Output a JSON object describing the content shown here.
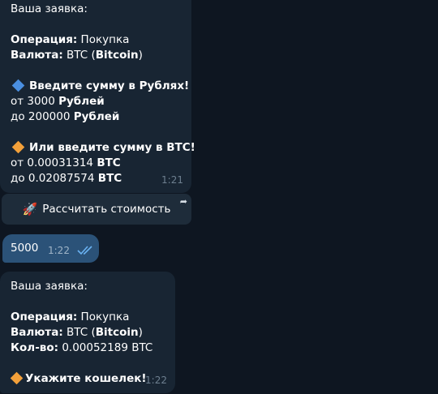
{
  "chat": {
    "msg1": {
      "header": "Ваша заявка:",
      "op_label": "Операция:",
      "op_value": " Покупка",
      "cur_label": "Валюта:",
      "cur_value_pre": " BTC (",
      "cur_value_name": "Bitcoin",
      "cur_value_post": ")",
      "rub_title": "Введите сумму в Рублях!",
      "rub_from_pre": "от ",
      "rub_from_val": "3000 ",
      "rub_from_unit": "Рублей",
      "rub_to_pre": "до ",
      "rub_to_val": "200000 ",
      "rub_to_unit": "Рублей",
      "btc_title": "Или введите сумму в BTC!",
      "btc_from_pre": "от ",
      "btc_from_val": "0.00031314 ",
      "btc_from_unit": "BTC",
      "btc_to_pre": "до ",
      "btc_to_val": "0.02087574 ",
      "btc_to_unit": "BTC",
      "time": "1:21",
      "icons": {
        "rub": "blue-diamond-icon",
        "btc": "orange-diamond-icon"
      },
      "colors": {
        "blue_diamond": "#4a8fe0",
        "orange_diamond": "#f2a03a"
      }
    },
    "inline_button": {
      "label": "Рассчитать стоимость",
      "icon": "rocket-icon"
    },
    "outgoing": {
      "text": "5000",
      "time": "1:22",
      "status_icon": "double-check-icon"
    },
    "msg2": {
      "header": "Ваша заявка:",
      "op_label": "Операция:",
      "op_value": " Покупка",
      "cur_label": "Валюта:",
      "cur_value_pre": " BTC (",
      "cur_value_name": "Bitcoin",
      "cur_value_post": ")",
      "qty_label": "Кол-во:",
      "qty_value": " 0.00052189 BTC",
      "wallet_prompt": "Укажите кошелек!",
      "time": "1:22"
    }
  }
}
